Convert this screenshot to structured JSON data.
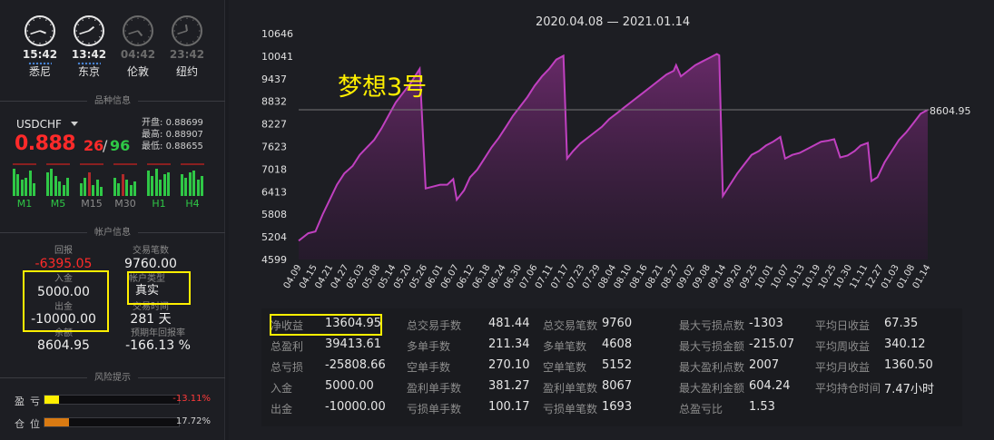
{
  "clocks": [
    {
      "time": "15:42",
      "city": "悉尼",
      "active": true,
      "hour": 15,
      "minute": 42
    },
    {
      "time": "13:42",
      "city": "东京",
      "active": true,
      "hour": 13,
      "minute": 42
    },
    {
      "time": "04:42",
      "city": "伦敦",
      "active": false,
      "hour": 4,
      "minute": 42
    },
    {
      "time": "23:42",
      "city": "纽约",
      "active": false,
      "hour": 23,
      "minute": 42
    }
  ],
  "sections": {
    "instrument": "品种信息",
    "account": "帐户信息",
    "risk": "风险提示"
  },
  "instrument": {
    "symbol": "USDCHF",
    "open_label": "开盘:",
    "open": "0.88699",
    "high_label": "最高:",
    "high": "0.88907",
    "low_label": "最低:",
    "low": "0.88655",
    "price_big": "0.888",
    "price_pip": "26",
    "price_slash": "/",
    "price_pip2": "96",
    "timeframes": [
      "M1",
      "M5",
      "M15",
      "M30",
      "H1",
      "H4"
    ],
    "timeframe_colors": [
      "#2fc846",
      "#2fc846",
      "#8a8a8a",
      "#8a8a8a",
      "#2fc846",
      "#2fc846"
    ]
  },
  "account": {
    "return_label": "回报",
    "return_value": "-6395.05",
    "trades_label": "交易笔数",
    "trades_value": "9760.00",
    "deposit_label": "入金",
    "deposit_value": "5000.00",
    "acct_type_label": "帐户类型",
    "acct_type_value": "真实",
    "withdraw_label": "出金",
    "withdraw_value": "-10000.00",
    "duration_label": "交易时间",
    "duration_value": "281 天",
    "balance_label": "余额",
    "balance_value": "8604.95",
    "annual_label": "预期年回报率",
    "annual_value": "-166.13 %"
  },
  "risk": {
    "pl_label": "盈亏",
    "pl_value": "-13.11%",
    "pl_fill": 0.11,
    "pos_label": "仓位",
    "pos_value": "17.72%",
    "pos_fill": 0.18
  },
  "chart": {
    "range": "2020.04.08 — 2021.01.14",
    "title": "梦想3号",
    "last_label": "8604.95"
  },
  "chart_data": {
    "type": "area",
    "title": "梦想3号",
    "subtitle": "2020.04.08 — 2021.01.14",
    "yticks": [
      4599,
      5204,
      5808,
      6413,
      7018,
      7623,
      8227,
      8832,
      9437,
      10041,
      10646
    ],
    "ylim": [
      4599,
      10646
    ],
    "xticks": [
      "04.09",
      "04.15",
      "04.21",
      "04.27",
      "05.03",
      "05.08",
      "05.14",
      "05.20",
      "05.26",
      "06.01",
      "06.07",
      "06.12",
      "06.18",
      "06.24",
      "06.30",
      "07.06",
      "07.11",
      "07.17",
      "07.23",
      "07.29",
      "08.04",
      "08.10",
      "08.16",
      "08.21",
      "08.27",
      "09.02",
      "09.08",
      "09.14",
      "09.20",
      "09.25",
      "10.01",
      "10.07",
      "10.13",
      "10.19",
      "10.25",
      "10.30",
      "11.11",
      "12.27",
      "01.03",
      "01.08",
      "01.14"
    ],
    "series": [
      {
        "values": [
          [
            0,
            5100
          ],
          [
            0.8,
            5300
          ],
          [
            1.4,
            5350
          ],
          [
            2,
            5800
          ],
          [
            2.6,
            6200
          ],
          [
            3.2,
            6600
          ],
          [
            3.8,
            6900
          ],
          [
            4.5,
            7100
          ],
          [
            5.1,
            7400
          ],
          [
            5.7,
            7600
          ],
          [
            6.3,
            7800
          ],
          [
            6.9,
            8100
          ],
          [
            7.5,
            8450
          ],
          [
            8.1,
            8800
          ],
          [
            8.7,
            9050
          ],
          [
            9.3,
            9300
          ],
          [
            9.9,
            9600
          ],
          [
            10.1,
            9700
          ],
          [
            10.6,
            6500
          ],
          [
            11.2,
            6550
          ],
          [
            11.8,
            6600
          ],
          [
            12.4,
            6600
          ],
          [
            12.9,
            6750
          ],
          [
            13.2,
            6200
          ],
          [
            13.8,
            6450
          ],
          [
            14.3,
            6800
          ],
          [
            14.9,
            7000
          ],
          [
            15.5,
            7300
          ],
          [
            16.1,
            7600
          ],
          [
            16.7,
            7850
          ],
          [
            17.3,
            8150
          ],
          [
            17.9,
            8450
          ],
          [
            18.5,
            8700
          ],
          [
            19.1,
            8950
          ],
          [
            19.7,
            9250
          ],
          [
            20.3,
            9500
          ],
          [
            20.9,
            9700
          ],
          [
            21.5,
            9950
          ],
          [
            22.1,
            10050
          ],
          [
            22.4,
            7300
          ],
          [
            22.9,
            7500
          ],
          [
            23.5,
            7700
          ],
          [
            24.1,
            7850
          ],
          [
            24.7,
            8000
          ],
          [
            25.3,
            8150
          ],
          [
            25.9,
            8350
          ],
          [
            26.5,
            8500
          ],
          [
            27.1,
            8650
          ],
          [
            27.7,
            8800
          ],
          [
            28.3,
            8950
          ],
          [
            28.9,
            9100
          ],
          [
            29.5,
            9250
          ],
          [
            30.1,
            9400
          ],
          [
            30.7,
            9550
          ],
          [
            31.3,
            9650
          ],
          [
            31.5,
            9800
          ],
          [
            31.9,
            9500
          ],
          [
            32.5,
            9650
          ],
          [
            33.1,
            9800
          ],
          [
            33.7,
            9900
          ],
          [
            34.3,
            10000
          ],
          [
            34.9,
            10100
          ],
          [
            35.1,
            10060
          ],
          [
            35.4,
            6300
          ],
          [
            36,
            6600
          ],
          [
            36.6,
            6900
          ],
          [
            37.2,
            7150
          ],
          [
            37.8,
            7400
          ],
          [
            38.4,
            7500
          ],
          [
            39,
            7650
          ],
          [
            39.6,
            7750
          ],
          [
            40.2,
            7880
          ],
          [
            40.6,
            7300
          ],
          [
            41.2,
            7400
          ],
          [
            41.8,
            7450
          ],
          [
            42.4,
            7550
          ],
          [
            43,
            7650
          ],
          [
            43.6,
            7750
          ],
          [
            44.2,
            7780
          ],
          [
            44.7,
            7820
          ],
          [
            45.2,
            7330
          ],
          [
            45.8,
            7380
          ],
          [
            46.4,
            7500
          ],
          [
            46.9,
            7650
          ],
          [
            47.5,
            7720
          ],
          [
            47.8,
            6700
          ],
          [
            48.3,
            6800
          ],
          [
            48.9,
            7200
          ],
          [
            49.5,
            7500
          ],
          [
            50.1,
            7800
          ],
          [
            50.7,
            8000
          ],
          [
            51.3,
            8250
          ],
          [
            51.9,
            8500
          ],
          [
            52.5,
            8604.95
          ]
        ]
      }
    ],
    "last_value": 8604.95,
    "line_color": "#c040c0",
    "grid": false
  },
  "stats": [
    [
      {
        "k": "净收益",
        "v": "13604.95"
      },
      {
        "k": "总盈利",
        "v": "39413.61"
      },
      {
        "k": "总亏损",
        "v": "-25808.66"
      },
      {
        "k": "入金",
        "v": "5000.00"
      },
      {
        "k": "出金",
        "v": "-10000.00"
      }
    ],
    [
      {
        "k": "总交易手数",
        "v": "481.44"
      },
      {
        "k": "多单手数",
        "v": "211.34"
      },
      {
        "k": "空单手数",
        "v": "270.10"
      },
      {
        "k": "盈利单手数",
        "v": "381.27"
      },
      {
        "k": "亏损单手数",
        "v": "100.17"
      }
    ],
    [
      {
        "k": "总交易笔数",
        "v": "9760"
      },
      {
        "k": "多单笔数",
        "v": "4608"
      },
      {
        "k": "空单笔数",
        "v": "5152"
      },
      {
        "k": "盈利单笔数",
        "v": "8067"
      },
      {
        "k": "亏损单笔数",
        "v": "1693"
      }
    ],
    [
      {
        "k": "最大亏损点数",
        "v": "-1303"
      },
      {
        "k": "最大亏损金额",
        "v": "-215.07"
      },
      {
        "k": "最大盈利点数",
        "v": "2007"
      },
      {
        "k": "最大盈利金额",
        "v": "604.24"
      },
      {
        "k": "总盈亏比",
        "v": "1.53"
      }
    ],
    [
      {
        "k": "平均日收益",
        "v": "67.35"
      },
      {
        "k": "平均周收益",
        "v": "340.12"
      },
      {
        "k": "平均月收益",
        "v": "1360.50"
      },
      {
        "k": "平均持仓时间",
        "v": "7.47小时"
      }
    ]
  ]
}
